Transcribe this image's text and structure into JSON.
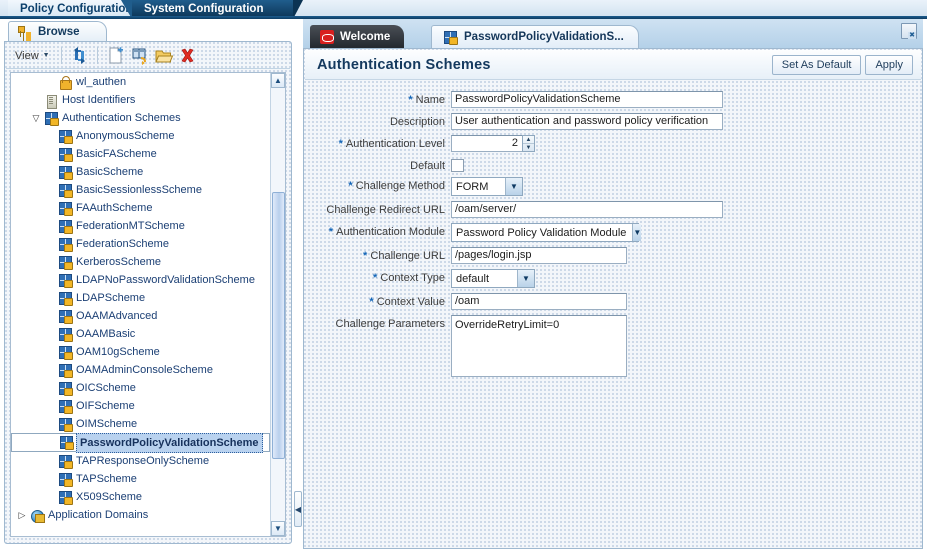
{
  "app_tabs": [
    {
      "label": "Policy Configuration",
      "active": false
    },
    {
      "label": "System Configuration",
      "active": true
    }
  ],
  "left_panel": {
    "tab_label": "Browse",
    "toolbar": {
      "view_label": "View",
      "view_caret": "▼",
      "icons": [
        {
          "name": "refresh-icon",
          "glyph": "⟳"
        },
        {
          "name": "create-icon",
          "glyph": "▤"
        },
        {
          "name": "search-icon",
          "glyph": "▥"
        },
        {
          "name": "open-folder-icon",
          "glyph": "▬"
        },
        {
          "name": "delete-icon",
          "glyph": "✖"
        }
      ]
    },
    "scrollbar": {
      "up": "▲",
      "down": "▼",
      "grip": "▤"
    },
    "tree": [
      {
        "label": "wl_authen",
        "indent": 2,
        "icon": "lock",
        "twisty": "",
        "selected": false
      },
      {
        "label": "Host Identifiers",
        "indent": 1,
        "icon": "host",
        "twisty": "",
        "selected": false
      },
      {
        "label": "Authentication Schemes",
        "indent": 1,
        "icon": "scheme",
        "twisty": "▽",
        "selected": false
      },
      {
        "label": "AnonymousScheme",
        "indent": 2,
        "icon": "scheme",
        "twisty": "",
        "selected": false
      },
      {
        "label": "BasicFAScheme",
        "indent": 2,
        "icon": "scheme",
        "twisty": "",
        "selected": false
      },
      {
        "label": "BasicScheme",
        "indent": 2,
        "icon": "scheme",
        "twisty": "",
        "selected": false
      },
      {
        "label": "BasicSessionlessScheme",
        "indent": 2,
        "icon": "scheme",
        "twisty": "",
        "selected": false
      },
      {
        "label": "FAAuthScheme",
        "indent": 2,
        "icon": "scheme",
        "twisty": "",
        "selected": false
      },
      {
        "label": "FederationMTScheme",
        "indent": 2,
        "icon": "scheme",
        "twisty": "",
        "selected": false
      },
      {
        "label": "FederationScheme",
        "indent": 2,
        "icon": "scheme",
        "twisty": "",
        "selected": false
      },
      {
        "label": "KerberosScheme",
        "indent": 2,
        "icon": "scheme",
        "twisty": "",
        "selected": false
      },
      {
        "label": "LDAPNoPasswordValidationScheme",
        "indent": 2,
        "icon": "scheme",
        "twisty": "",
        "selected": false
      },
      {
        "label": "LDAPScheme",
        "indent": 2,
        "icon": "scheme",
        "twisty": "",
        "selected": false
      },
      {
        "label": "OAAMAdvanced",
        "indent": 2,
        "icon": "scheme",
        "twisty": "",
        "selected": false
      },
      {
        "label": "OAAMBasic",
        "indent": 2,
        "icon": "scheme",
        "twisty": "",
        "selected": false
      },
      {
        "label": "OAM10gScheme",
        "indent": 2,
        "icon": "scheme",
        "twisty": "",
        "selected": false
      },
      {
        "label": "OAMAdminConsoleScheme",
        "indent": 2,
        "icon": "scheme",
        "twisty": "",
        "selected": false
      },
      {
        "label": "OICScheme",
        "indent": 2,
        "icon": "scheme",
        "twisty": "",
        "selected": false
      },
      {
        "label": "OIFScheme",
        "indent": 2,
        "icon": "scheme",
        "twisty": "",
        "selected": false
      },
      {
        "label": "OIMScheme",
        "indent": 2,
        "icon": "scheme",
        "twisty": "",
        "selected": false
      },
      {
        "label": "PasswordPolicyValidationScheme",
        "indent": 2,
        "icon": "scheme",
        "twisty": "",
        "selected": true
      },
      {
        "label": "TAPResponseOnlyScheme",
        "indent": 2,
        "icon": "scheme",
        "twisty": "",
        "selected": false
      },
      {
        "label": "TAPScheme",
        "indent": 2,
        "icon": "scheme",
        "twisty": "",
        "selected": false
      },
      {
        "label": "X509Scheme",
        "indent": 2,
        "icon": "scheme",
        "twisty": "",
        "selected": false
      },
      {
        "label": "Application Domains",
        "indent": 0,
        "icon": "globe",
        "twisty": "▷",
        "selected": false
      }
    ]
  },
  "splitter": {
    "collapse_glyph": "◀"
  },
  "right_panel": {
    "tabs": [
      {
        "label": "Welcome",
        "icon": "oracle-icon",
        "active": false
      },
      {
        "label": "PasswordPolicyValidationS...",
        "icon": "scheme-icon",
        "active": true
      }
    ],
    "detach_icon": "detach-icon",
    "page_title": "Authentication Schemes",
    "buttons": [
      {
        "label": "Set As Default",
        "name": "set-as-default-button"
      },
      {
        "label": "Apply",
        "name": "apply-button"
      }
    ],
    "form": {
      "name": {
        "label": "Name",
        "required": true,
        "value": "PasswordPolicyValidationScheme"
      },
      "description": {
        "label": "Description",
        "required": false,
        "value": "User authentication and password policy verification"
      },
      "auth_level": {
        "label": "Authentication Level",
        "required": true,
        "value": "2",
        "spin_up": "▲",
        "spin_down": "▼"
      },
      "default": {
        "label": "Default",
        "required": false,
        "checked": false
      },
      "challenge_method": {
        "label": "Challenge Method",
        "required": true,
        "value": "FORM",
        "caret": "▼"
      },
      "challenge_redirect_url": {
        "label": "Challenge Redirect URL",
        "required": false,
        "value": "/oam/server/"
      },
      "auth_module": {
        "label": "Authentication Module",
        "required": true,
        "value": "Password Policy Validation Module",
        "caret": "▼"
      },
      "challenge_url": {
        "label": "Challenge URL",
        "required": true,
        "value": "/pages/login.jsp"
      },
      "context_type": {
        "label": "Context Type",
        "required": true,
        "value": "default",
        "caret": "▼"
      },
      "context_value": {
        "label": "Context Value",
        "required": true,
        "value": "/oam"
      },
      "challenge_parameters": {
        "label": "Challenge Parameters",
        "required": false,
        "value": "OverrideRetryLimit=0"
      }
    }
  }
}
